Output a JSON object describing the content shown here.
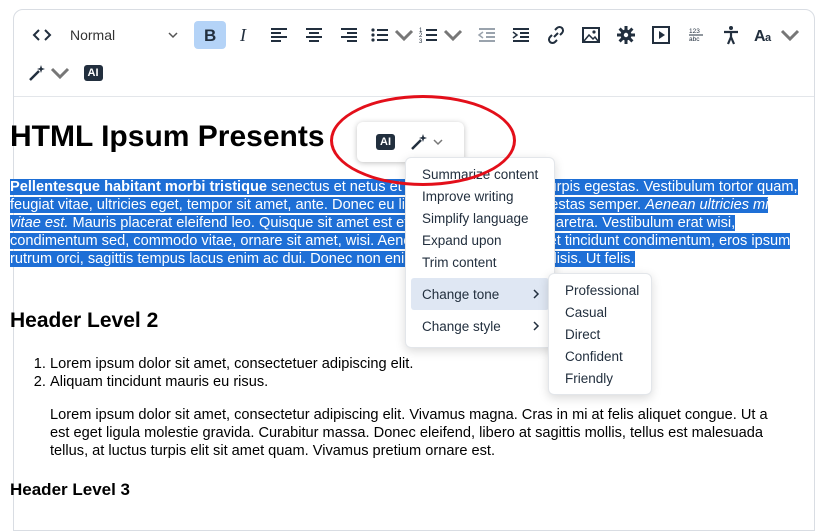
{
  "toolbar": {
    "block_format": "Normal",
    "icons": [
      "code-icon",
      "bold-icon",
      "italic-icon",
      "align-left-icon",
      "align-center-icon",
      "align-right-icon",
      "bullet-list-icon",
      "numbered-list-icon",
      "outdent-icon",
      "indent-icon",
      "link-icon",
      "image-icon",
      "settings-icon",
      "media-icon",
      "wordcount-icon",
      "accessibility-icon",
      "font-size-icon",
      "ai-wand-icon",
      "ai-assistant-icon"
    ],
    "ai_label": "AI"
  },
  "document": {
    "title": "HTML Ipsum Presents",
    "paragraph_bold": "Pellentesque habitant morbi tristique",
    "paragraph_part1": " senectus et netus et malesuada fames ac turpis egestas. Vestibulum tortor quam, feugiat vitae, ultricies eget, tempor sit amet, ante. Donec eu libero sit amet quam egestas semper. ",
    "paragraph_italic": "Aenean ultricies mi vitae est.",
    "paragraph_part2": " Mauris placerat eleifend leo. Quisque sit amet est et sapien ullamcorper pharetra. Vestibulum erat wisi, condimentum sed, commodo vitae, ornare sit amet, wisi. Aenean fermentum, elit eget tincidunt condimentum, eros ipsum rutrum orci, sagittis tempus lacus enim ac dui. Donec non enim in turpis pulvinar facilisis. Ut felis.",
    "header2": "Header Level 2",
    "list": [
      "Lorem ipsum dolor sit amet, consectetuer adipiscing elit.",
      "Aliquam tincidunt mauris eu risus."
    ],
    "inner_paragraph": "Lorem ipsum dolor sit amet, consectetur adipiscing elit. Vivamus magna. Cras in mi at felis aliquet congue. Ut a est eget ligula molestie gravida. Curabitur massa. Donec eleifend, libero at sagittis mollis, tellus est malesuada tellus, at luctus turpis elit sit amet quam. Vivamus pretium ornare est.",
    "header3": "Header Level 3"
  },
  "floating_toolbar": {
    "ai_label": "AI"
  },
  "ai_menu": {
    "items": [
      "Summarize content",
      "Improve writing",
      "Simplify language",
      "Expand upon",
      "Trim content",
      "Change tone",
      "Change style"
    ]
  },
  "tone_submenu": {
    "items": [
      "Professional",
      "Casual",
      "Direct",
      "Confident",
      "Friendly"
    ]
  },
  "colors": {
    "selection": "#1e6fd6",
    "annotation_ring": "#e30f1a",
    "active_button": "#b4d3f7"
  }
}
